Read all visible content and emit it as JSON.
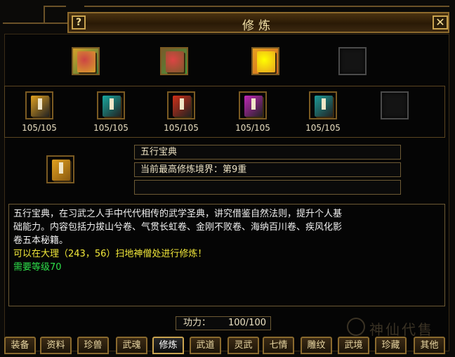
{
  "window": {
    "title": "修炼",
    "help_label": "?",
    "close_label": "✕"
  },
  "top_icons": [
    {
      "name": "five-elements-book-icon",
      "colors": [
        "#d8a12a",
        "#3a7a3a",
        "#c44"
      ]
    },
    {
      "name": "scroll-bundle-icon",
      "colors": [
        "#7a5a2a",
        "#3d9a3d",
        "#d44"
      ]
    },
    {
      "name": "golden-treasure-icon",
      "colors": [
        "#e8a020",
        "#c62",
        "#ff0"
      ]
    },
    {
      "name": "empty-slot-icon"
    }
  ],
  "books": [
    {
      "name": "yellow-book-icon",
      "color": "#e0a020",
      "count": "105/105"
    },
    {
      "name": "cyan-book-icon",
      "color": "#18a8a0",
      "count": "105/105"
    },
    {
      "name": "red-book-icon",
      "color": "#d03018",
      "count": "105/105"
    },
    {
      "name": "magenta-book-icon",
      "color": "#c028b8",
      "count": "105/105"
    },
    {
      "name": "teal-book-icon",
      "color": "#1c9a98",
      "count": "105/105"
    },
    {
      "name": "empty-slot-icon"
    }
  ],
  "selected": {
    "name": "五行宝典",
    "realm": "当前最高修炼境界：第9重",
    "extra": ""
  },
  "description": {
    "text": "五行宝典，在习武之人手中代代相传的武学圣典，讲究借鉴自然法则，提升个人基础能力。内容包括力拔山兮卷、气贯长虹卷、金刚不败卷、海纳百川卷、疾风化影卷五本秘籍。",
    "line1": "五行宝典，在习武之人手中代代相传的武学圣典，讲究借鉴自然法则，提升个人基",
    "line2": "础能力。内容包括力拔山兮卷、气贯长虹卷、金刚不败卷、海纳百川卷、疾风化影",
    "line3": "卷五本秘籍。",
    "location": "可以在大理（243，56）扫地神僧处进行修炼！",
    "requirement": "需要等级70"
  },
  "gongli": {
    "label": "功力：",
    "value": "100/100"
  },
  "tabs": [
    "装备",
    "资料",
    "珍兽",
    "武魂",
    "修炼",
    "武道",
    "灵武",
    "七情",
    "雕纹",
    "武境",
    "珍藏",
    "其他"
  ],
  "active_tab": "修炼",
  "watermark": "神仙代售"
}
